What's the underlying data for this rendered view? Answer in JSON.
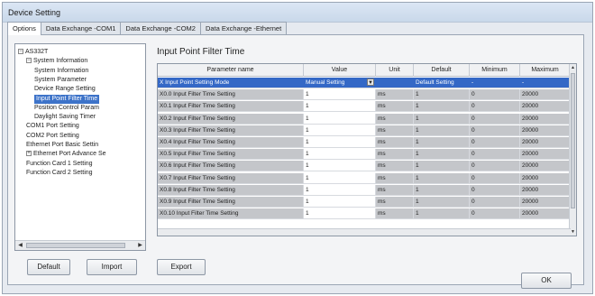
{
  "window": {
    "title": "Device Setting"
  },
  "tabs": [
    "Options",
    "Data Exchange -COM1",
    "Data Exchange -COM2",
    "Data Exchange -Ethernet"
  ],
  "tree": [
    {
      "label": "AS332T",
      "toggle": "⊟",
      "indent": 0
    },
    {
      "label": "System Information",
      "toggle": "⊟",
      "indent": 1
    },
    {
      "label": "System Information",
      "toggle": "",
      "indent": 2
    },
    {
      "label": "System Parameter",
      "toggle": "",
      "indent": 2
    },
    {
      "label": "Device Range Setting",
      "toggle": "",
      "indent": 2
    },
    {
      "label": "Input Point Filter Time",
      "toggle": "",
      "indent": 2,
      "selected": true
    },
    {
      "label": "Position Control Param",
      "toggle": "",
      "indent": 2
    },
    {
      "label": "Daylight Saving Timer",
      "toggle": "",
      "indent": 2
    },
    {
      "label": "COM1 Port Setting",
      "toggle": "",
      "indent": 1
    },
    {
      "label": "COM2 Port Setting",
      "toggle": "",
      "indent": 1
    },
    {
      "label": "Ethernet Port Basic Settin",
      "toggle": "",
      "indent": 1
    },
    {
      "label": "Ethernet Port Advance Se",
      "toggle": "⊞",
      "indent": 1
    },
    {
      "label": "Function Card 1 Setting",
      "toggle": "",
      "indent": 1
    },
    {
      "label": "Function Card 2 Setting",
      "toggle": "",
      "indent": 1
    }
  ],
  "section_title": "Input Point Filter Time",
  "grid": {
    "columns": [
      "Parameter name",
      "Value",
      "Unit",
      "Default",
      "Minimum",
      "Maximum"
    ],
    "rows": [
      {
        "name": "X Input Point Setting Mode",
        "value": "Manual Setting",
        "unit": "",
        "default": "Default Setting",
        "minimum": "-",
        "maximum": "-",
        "highlight": true,
        "dropdown": true
      },
      {
        "name": "X0.0 Input Filter Time Setting",
        "value": "1",
        "unit": "ms",
        "default": "1",
        "minimum": "0",
        "maximum": "20000"
      },
      {
        "name": "X0.1 Input Filter Time Setting",
        "value": "1",
        "unit": "ms",
        "default": "1",
        "minimum": "0",
        "maximum": "20000"
      },
      {
        "name": "X0.2 Input Filter Time Setting",
        "value": "1",
        "unit": "ms",
        "default": "1",
        "minimum": "0",
        "maximum": "20000"
      },
      {
        "name": "X0.3 Input Filter Time Setting",
        "value": "1",
        "unit": "ms",
        "default": "1",
        "minimum": "0",
        "maximum": "20000"
      },
      {
        "name": "X0.4 Input Filter Time Setting",
        "value": "1",
        "unit": "ms",
        "default": "1",
        "minimum": "0",
        "maximum": "20000"
      },
      {
        "name": "X0.5 Input Filter Time Setting",
        "value": "1",
        "unit": "ms",
        "default": "1",
        "minimum": "0",
        "maximum": "20000"
      },
      {
        "name": "X0.6 Input Filter Time Setting",
        "value": "1",
        "unit": "ms",
        "default": "1",
        "minimum": "0",
        "maximum": "20000"
      },
      {
        "name": "X0.7 Input Filter Time Setting",
        "value": "1",
        "unit": "ms",
        "default": "1",
        "minimum": "0",
        "maximum": "20000"
      },
      {
        "name": "X0.8 Input Filter Time Setting",
        "value": "1",
        "unit": "ms",
        "default": "1",
        "minimum": "0",
        "maximum": "20000"
      },
      {
        "name": "X0.9 Input Filter Time Setting",
        "value": "1",
        "unit": "ms",
        "default": "1",
        "minimum": "0",
        "maximum": "20000"
      },
      {
        "name": "X0.10 Input Filter Time Setting",
        "value": "1",
        "unit": "ms",
        "default": "1",
        "minimum": "0",
        "maximum": "20000"
      }
    ]
  },
  "buttons": {
    "default": "Default",
    "import": "Import",
    "export": "Export",
    "ok": "OK"
  }
}
